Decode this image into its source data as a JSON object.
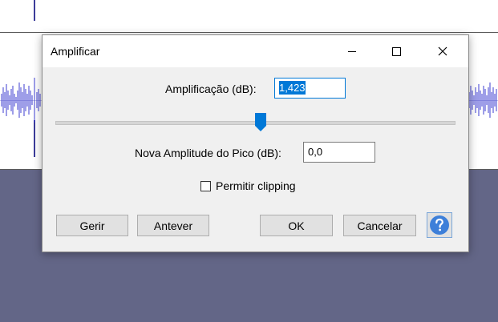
{
  "dialog": {
    "title": "Amplificar",
    "amplification_label": "Amplificação (dB):",
    "amplification_value": "1,423",
    "amplification_slider_value_db": 1.423,
    "peak_label": "Nova Amplitude do Pico (dB):",
    "peak_value": "0,0",
    "clipping_label": "Permitir clipping",
    "clipping_checked": false,
    "buttons": {
      "manage": "Gerir",
      "preview": "Antever",
      "ok": "OK",
      "cancel": "Cancelar"
    }
  },
  "colors": {
    "waveform": "#3c3cd2",
    "background_track": "#636687",
    "accent": "#0078d7"
  },
  "icons": [
    "minimize-icon",
    "maximize-icon",
    "close-icon",
    "help-icon",
    "slider-thumb"
  ]
}
